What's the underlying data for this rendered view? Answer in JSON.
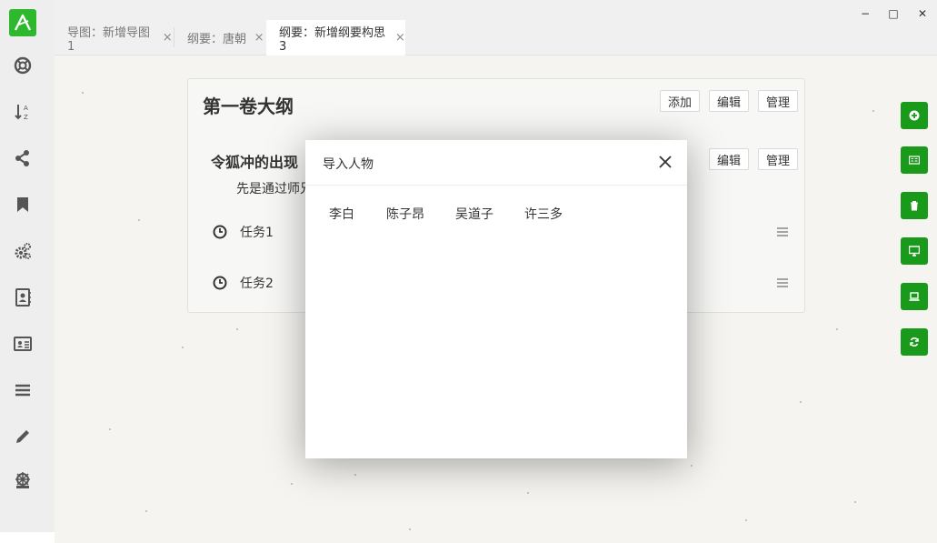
{
  "app": {
    "logo_label": "A"
  },
  "sidebar": {
    "items": [
      {
        "icon": "lifebuoy-icon"
      },
      {
        "icon": "sort-alpha-icon",
        "label": "A Z"
      },
      {
        "icon": "share-icon"
      },
      {
        "icon": "bookmark-icon"
      },
      {
        "icon": "gears-icon"
      },
      {
        "icon": "address-book-icon"
      },
      {
        "icon": "id-card-icon"
      },
      {
        "icon": "list-icon"
      },
      {
        "icon": "pencil-icon"
      },
      {
        "icon": "helm-icon"
      }
    ]
  },
  "tabs": [
    {
      "label": "导图：新增导图1",
      "close": "×",
      "active": false
    },
    {
      "label": "纲要：唐朝",
      "close": "×",
      "active": false
    },
    {
      "label": "纲要：新增纲要构思3",
      "close": "×",
      "active": true
    }
  ],
  "window": {
    "minimize": "−",
    "maximize": "□",
    "close": "✕"
  },
  "outline": {
    "title": "第一卷大纲",
    "buttons": {
      "add": "添加",
      "edit": "编辑",
      "manage": "管理"
    },
    "chapter": {
      "title": "令狐冲的出现",
      "description": "先是通过师兄",
      "buttons": {
        "edit": "编辑",
        "manage": "管理"
      },
      "tasks": [
        {
          "label": "任务1"
        },
        {
          "label": "任务2"
        }
      ]
    }
  },
  "right_actions": [
    {
      "icon": "plus-circle-icon"
    },
    {
      "icon": "card-icon"
    },
    {
      "icon": "trash-icon"
    },
    {
      "icon": "monitor-icon"
    },
    {
      "icon": "laptop-icon"
    },
    {
      "icon": "refresh-icon"
    }
  ],
  "modal": {
    "title": "导入人物",
    "people": [
      "李白",
      "陈子昂",
      "吴道子",
      "许三多"
    ]
  },
  "colors": {
    "accent": "#1a9a1a",
    "logo": "#2eb82e",
    "sidebar_bg": "#eeeeee",
    "paper_bg": "#f5f4f0"
  }
}
